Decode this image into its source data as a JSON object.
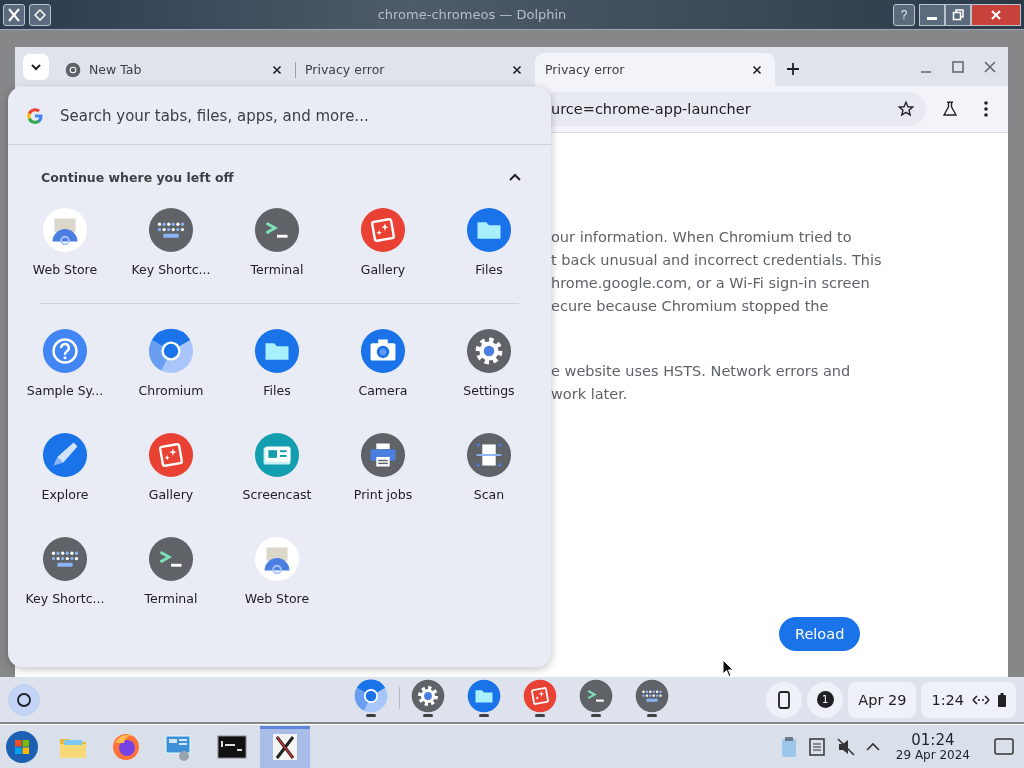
{
  "window": {
    "title": "chrome-chromeos — Dolphin",
    "help_button": "?"
  },
  "browser": {
    "tabs": [
      {
        "label": "New Tab",
        "selected": false,
        "favicon": true
      },
      {
        "label": "Privacy error",
        "selected": false,
        "favicon": false
      },
      {
        "label": "Privacy error",
        "selected": true,
        "favicon": false
      }
    ],
    "address": "urce=chrome-app-launcher",
    "page": {
      "paragraphs": [
        [
          "our information. When Chromium tried to",
          "t back unusual and incorrect credentials. This",
          "hrome.google.com, or a Wi-Fi sign-in screen",
          "ecure because Chromium stopped the"
        ],
        [
          "e website uses HSTS. Network errors and",
          "work later."
        ]
      ],
      "reload_button": "Reload"
    }
  },
  "launcher": {
    "search": {
      "placeholder": "Search your tabs, files, apps, and more..."
    },
    "continue": {
      "heading": "Continue where you left off",
      "expanded": true,
      "items": [
        {
          "name": "Web Store",
          "kind": "webstore"
        },
        {
          "name": "Key Shortc...",
          "kind": "keyboard"
        },
        {
          "name": "Terminal",
          "kind": "terminal"
        },
        {
          "name": "Gallery",
          "kind": "gallery"
        },
        {
          "name": "Files",
          "kind": "files"
        }
      ]
    },
    "apps": [
      {
        "name": "Sample Sy...",
        "kind": "help"
      },
      {
        "name": "Chromium",
        "kind": "chromium"
      },
      {
        "name": "Files",
        "kind": "files"
      },
      {
        "name": "Camera",
        "kind": "camera"
      },
      {
        "name": "Settings",
        "kind": "settings"
      },
      {
        "name": "Explore",
        "kind": "explore"
      },
      {
        "name": "Gallery",
        "kind": "gallery"
      },
      {
        "name": "Screencast",
        "kind": "screencast"
      },
      {
        "name": "Print jobs",
        "kind": "print"
      },
      {
        "name": "Scan",
        "kind": "scan"
      },
      {
        "name": "Key Shortc...",
        "kind": "keyboard"
      },
      {
        "name": "Terminal",
        "kind": "terminal"
      },
      {
        "name": "Web Store",
        "kind": "webstore"
      }
    ]
  },
  "shelf": {
    "apps": [
      {
        "kind": "chromium"
      },
      {
        "kind": "settings"
      },
      {
        "kind": "files"
      },
      {
        "kind": "gallery"
      },
      {
        "kind": "terminal"
      },
      {
        "kind": "keyboard"
      }
    ],
    "notification_count": "1",
    "date": "Apr 29",
    "time": "1:24"
  },
  "taskbar": {
    "apps": [
      {
        "kind": "folder",
        "selected": false
      },
      {
        "kind": "firefox",
        "selected": false
      },
      {
        "kind": "remote",
        "selected": false
      },
      {
        "kind": "console",
        "selected": false
      },
      {
        "kind": "xapp",
        "selected": true
      }
    ],
    "clock": {
      "time": "01:24",
      "date": "29 Apr 2024"
    }
  }
}
